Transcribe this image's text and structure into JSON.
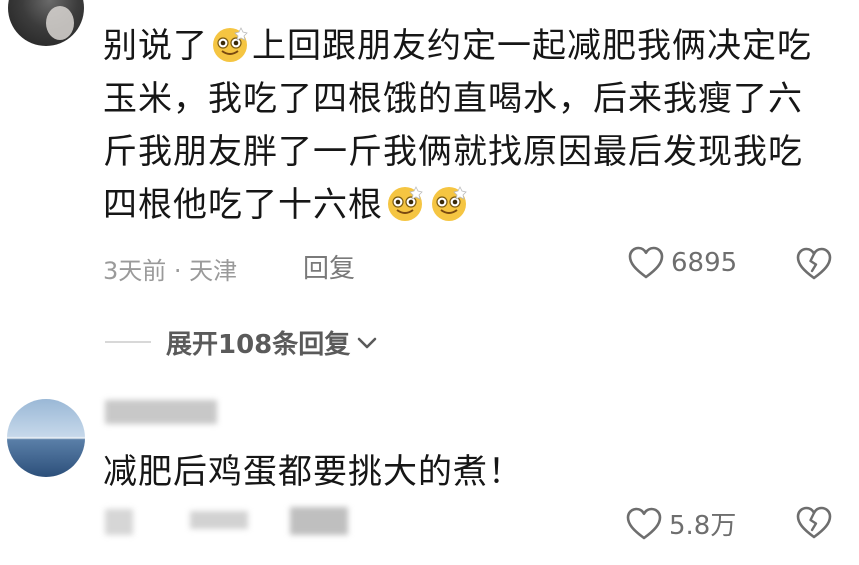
{
  "comment_1": {
    "text_parts": [
      "别说了",
      "上回跟朋友约定一起减肥我俩决定吃玉米，我吃了四根饿的直喝水，后来我瘦了六斤我朋友胖了一斤我俩就找原因最后发现我吃四根他吃了十六根"
    ],
    "emoji": "smiling-sweat-emoji",
    "meta": "3天前 · 天津",
    "reply_label": "回复",
    "like_count": "6895"
  },
  "expand_replies": {
    "label": "展开108条回复"
  },
  "comment_2": {
    "text": "减肥后鸡蛋都要挑大的煮！",
    "like_count": "5.8万"
  },
  "icons": {
    "like": "heart-outline-icon",
    "dislike": "broken-heart-icon",
    "expand": "chevron-down-icon"
  },
  "colors": {
    "text": "#161616",
    "meta": "#9a9a9a",
    "like": "#6e6e6e"
  }
}
